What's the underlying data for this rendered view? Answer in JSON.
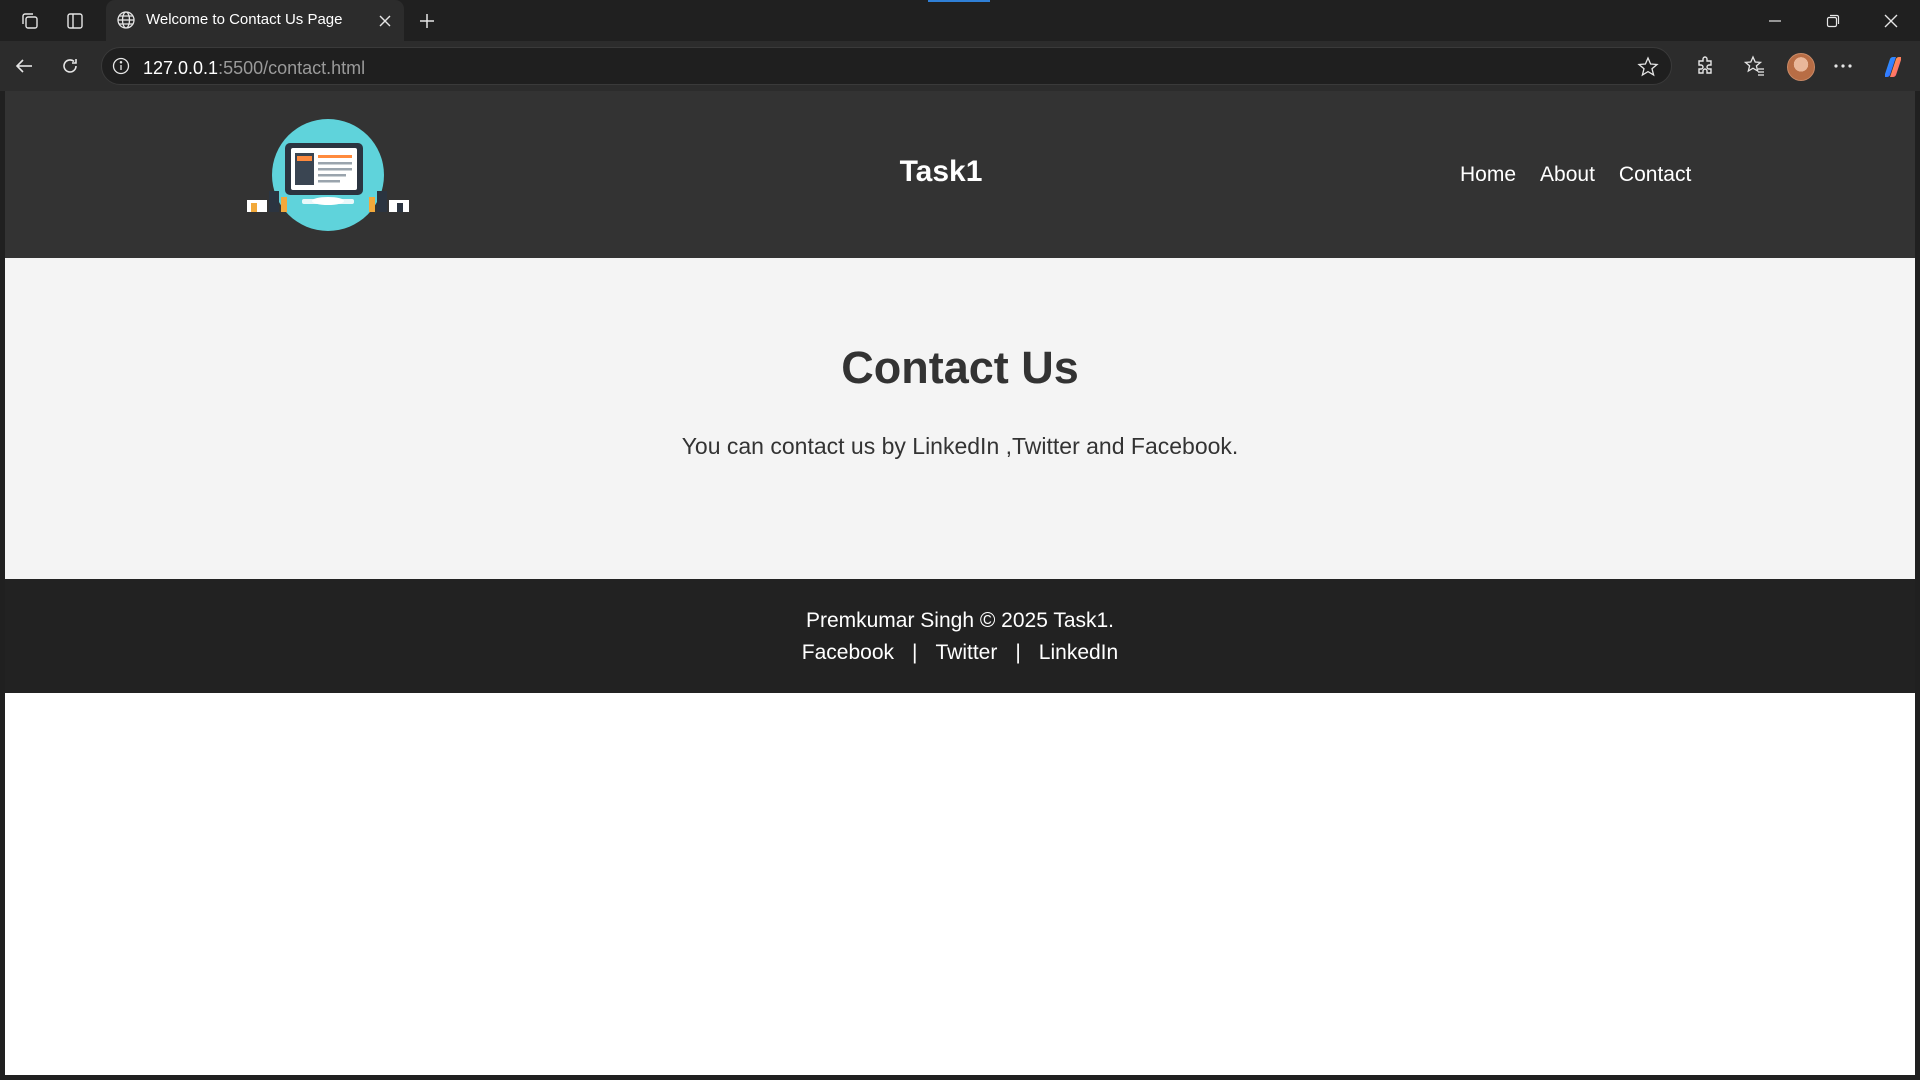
{
  "browser": {
    "tab_title": "Welcome to Contact Us Page",
    "url_host": "127.0.0.1",
    "url_rest": ":5500/contact.html",
    "icons": [
      "workspaces-icon",
      "vertical-tabs-icon",
      "globe-icon",
      "close-icon",
      "new-tab-icon",
      "minimize-icon",
      "restore-icon",
      "window-close-icon",
      "back-icon",
      "refresh-icon",
      "info-icon",
      "star-icon",
      "extensions-icon",
      "favorites-icon",
      "avatar",
      "more-icon",
      "copilot-icon"
    ]
  },
  "site": {
    "title": "Task1",
    "nav": [
      "Home",
      "About",
      "Contact"
    ],
    "heading": "Contact Us",
    "text": "You can contact us by LinkedIn ,Twitter and Facebook.",
    "footer": {
      "copyright": "Premkumar Singh © 2025 Task1.",
      "links": [
        "Facebook",
        "Twitter",
        "LinkedIn"
      ],
      "separator": "|"
    }
  },
  "colors": {
    "header_bg": "#333333",
    "content_bg": "#f4f4f4",
    "footer_bg": "#222222",
    "logo_circle": "#5fd3db"
  }
}
